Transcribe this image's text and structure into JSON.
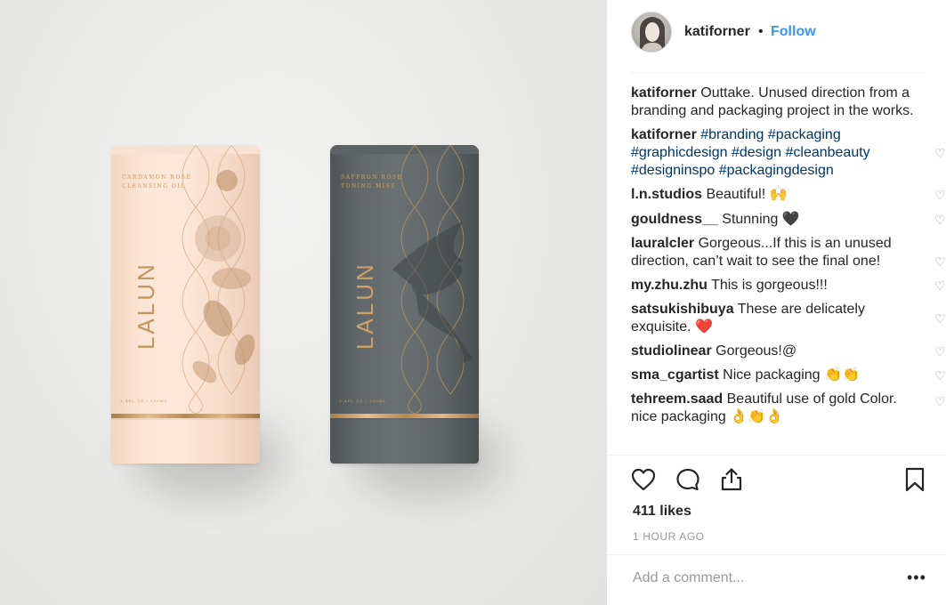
{
  "photo": {
    "tube_left": {
      "brand": "LALUN",
      "product": "CARDAMON ROSE\nCLEANSING OIL",
      "volume": "3.4FL OZ / 100ML"
    },
    "tube_right": {
      "brand": "LALUN",
      "product": "SAFFRON ROSE\nTONING MIST",
      "volume": "3.4FL OZ / 100ML"
    }
  },
  "post": {
    "username": "katiforner",
    "separator": "•",
    "follow_label": "Follow",
    "caption_user": "katiforner",
    "caption": "Outtake. Unused direction from a branding and packaging project in the works.",
    "hashtag_user": "katiforner",
    "hashtags": [
      "#branding",
      "#packaging",
      "#graphicdesign",
      "#design",
      "#cleanbeauty",
      "#designinspo",
      "#packagingdesign"
    ],
    "comments": [
      {
        "user": "l.n.studios",
        "text": "Beautiful! 🙌"
      },
      {
        "user": "gouldness__",
        "text": "Stunning 🖤"
      },
      {
        "user": "lauralcler",
        "text": "Gorgeous...If this is an unused direction, can’t wait to see the final one!"
      },
      {
        "user": "my.zhu.zhu",
        "text": "This is gorgeous!!!"
      },
      {
        "user": "satsukishibuya",
        "text": "These are delicately exquisite. ❤️"
      },
      {
        "user": "studiolinear",
        "text": "Gorgeous!@"
      },
      {
        "user": "sma_cgartist",
        "text": "Nice packaging 👏👏"
      },
      {
        "user": "tehreem.saad",
        "text": "Beautiful use of gold Color. nice packaging 👌👏👌"
      }
    ],
    "likes": "411 likes",
    "time": "1 HOUR AGO",
    "add_comment_placeholder": "Add a comment...",
    "more_label": "•••",
    "colors": {
      "link": "#3897f0",
      "hashtag": "#003569",
      "muted": "#999999"
    }
  }
}
